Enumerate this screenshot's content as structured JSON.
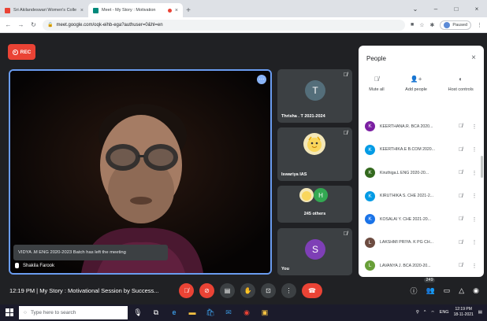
{
  "browser": {
    "tabs": [
      {
        "title": "Sri Akilandeswari Women's Colle",
        "close": "×",
        "active": false
      },
      {
        "title": "Meet - My Story : Motivation",
        "close": "×",
        "active": true
      }
    ],
    "new_tab": "+",
    "window_controls": {
      "minimize": "–",
      "maximize": "□",
      "close": "×"
    },
    "url": "meet.google.com/oqk-eihb-ega?authuser=0&hl=en",
    "profile_status": "Paused"
  },
  "meet": {
    "rec_label": "REC",
    "toast": "VIDYA .M ENG 2020-2023 Batch has left the meeting",
    "main_speaker": "Shakila Farook",
    "tiles": [
      {
        "name": "Thrisha . T 2021-2024",
        "initial": "T",
        "color": "#546e7a"
      },
      {
        "name": "Iswariya IAS",
        "initial": "",
        "color": "#f9d65c"
      },
      {
        "name": "245 others",
        "initial": "H",
        "color": "#33a852"
      },
      {
        "name": "You",
        "initial": "S",
        "color": "#7e3fb6"
      }
    ],
    "meeting_info": "12:19 PM  |  My Story : Motivational Session by Success...",
    "participant_count": "249"
  },
  "people_panel": {
    "title": "People",
    "close": "×",
    "actions": [
      {
        "label": "Mute all",
        "icon": "mic-off-icon"
      },
      {
        "label": "Add people",
        "icon": "person-add-icon"
      },
      {
        "label": "Host controls",
        "icon": "toggle-icon"
      }
    ],
    "participants": [
      {
        "initial": "K",
        "name": "KEERTHANA.R. BCA 2020...",
        "color": "#7b1fa2"
      },
      {
        "initial": "K",
        "name": "KEERTHIKA.E B.COM 2020...",
        "color": "#039be5"
      },
      {
        "initial": "K",
        "name": "Kiruthiga.L ENG 2020-20...",
        "color": "#33691e"
      },
      {
        "initial": "K",
        "name": "KIRUTHIKA S. CHE 2021-2...",
        "color": "#039be5"
      },
      {
        "initial": "K",
        "name": "KOSALAI Y. CHE 2021-20...",
        "color": "#1a73e8"
      },
      {
        "initial": "L",
        "name": "LAKSHMI PRIYA. K PG CH...",
        "color": "#6d4c41"
      },
      {
        "initial": "L",
        "name": "LAVANYA J. BCA 2020-20...",
        "color": "#689f38"
      }
    ]
  },
  "taskbar": {
    "search_placeholder": "Type here to search",
    "tray_lang": "ENG",
    "time": "12:19 PM",
    "date": "18-11-2021"
  }
}
